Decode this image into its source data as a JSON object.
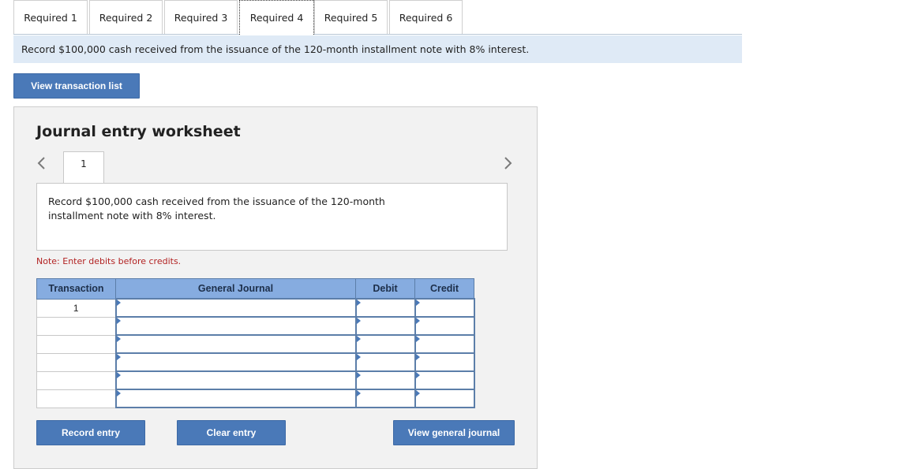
{
  "tabs": [
    {
      "label": "Required 1"
    },
    {
      "label": "Required 2"
    },
    {
      "label": "Required 3"
    },
    {
      "label": "Required 4"
    },
    {
      "label": "Required 5"
    },
    {
      "label": "Required 6"
    }
  ],
  "active_tab": "Required 4",
  "banner_text": "Record $100,000 cash received from the issuance of the 120-month installment note with 8% interest.",
  "view_transaction_list_label": "View transaction list",
  "worksheet": {
    "title": "Journal entry worksheet",
    "current_page": "1",
    "description": "Record $100,000 cash received from the issuance of the 120-month installment note with 8% interest.",
    "note": "Note: Enter debits before credits.",
    "columns": [
      "Transaction",
      "General Journal",
      "Debit",
      "Credit"
    ],
    "rows": [
      {
        "transaction": "1",
        "account": "",
        "debit": "",
        "credit": ""
      },
      {
        "transaction": "",
        "account": "",
        "debit": "",
        "credit": ""
      },
      {
        "transaction": "",
        "account": "",
        "debit": "",
        "credit": ""
      },
      {
        "transaction": "",
        "account": "",
        "debit": "",
        "credit": ""
      },
      {
        "transaction": "",
        "account": "",
        "debit": "",
        "credit": ""
      },
      {
        "transaction": "",
        "account": "",
        "debit": "",
        "credit": ""
      }
    ],
    "buttons": {
      "record": "Record entry",
      "clear": "Clear entry",
      "view_journal": "View general journal"
    }
  },
  "colors": {
    "accent": "#4a79b8",
    "table_header": "#86ace0",
    "banner_bg": "#dfeaf6",
    "note": "#b22222"
  },
  "icons": {
    "prev": "chevron-left-icon",
    "next": "chevron-right-icon"
  }
}
